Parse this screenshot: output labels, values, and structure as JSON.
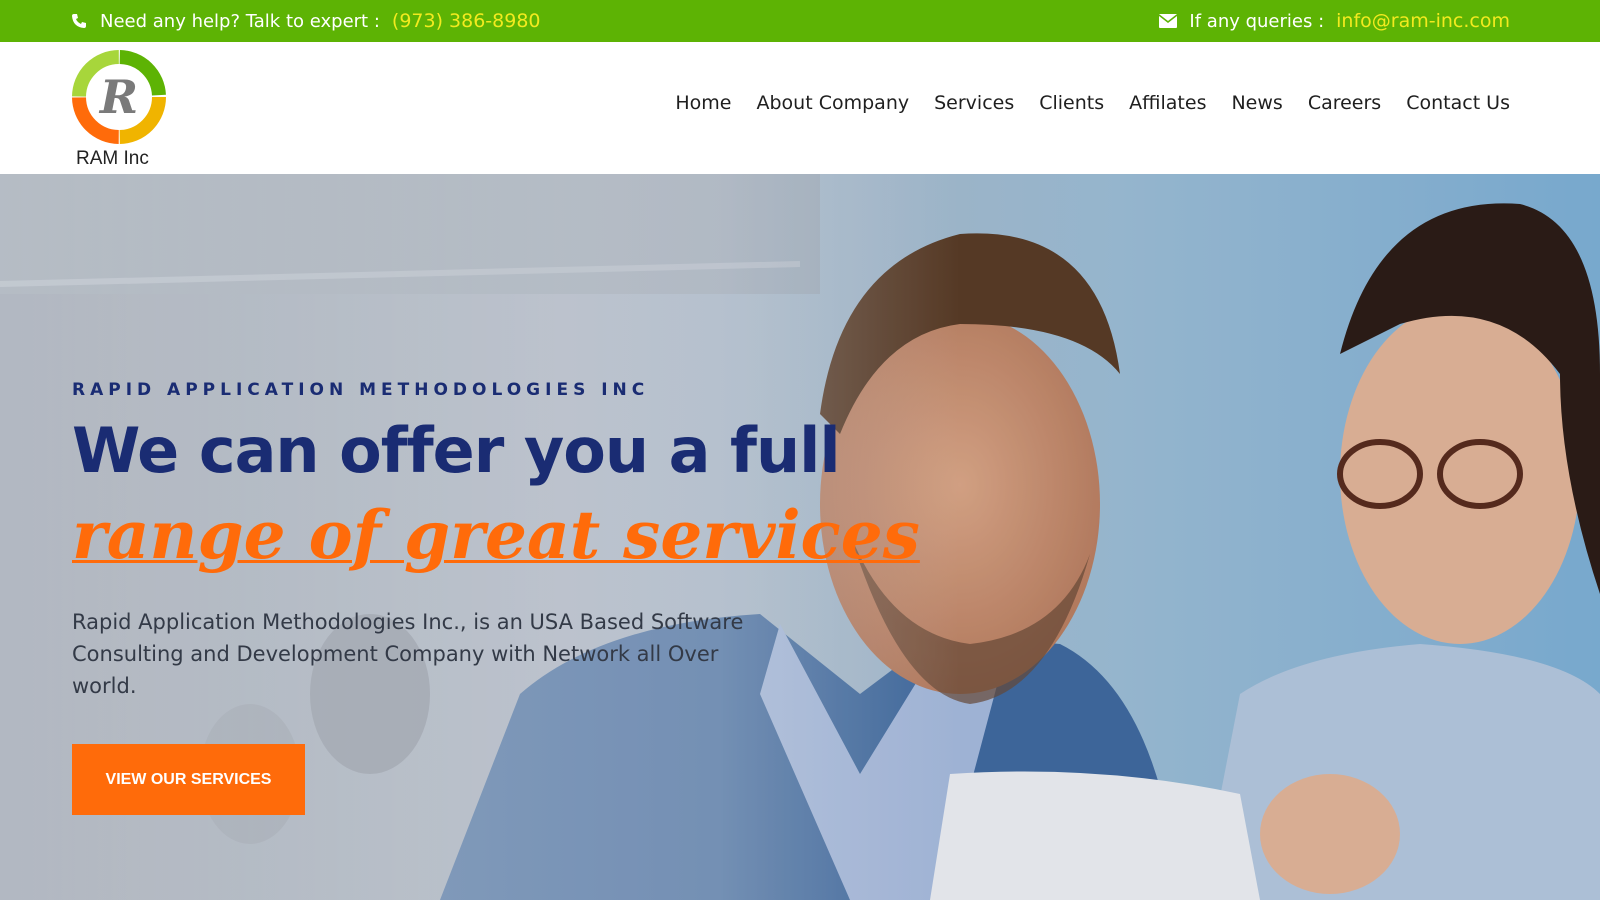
{
  "topbar": {
    "help_label": "Need any help? Talk to expert :",
    "phone": "(973) 386-8980",
    "query_label": "If any queries :",
    "email": "info@ram-inc.com",
    "phone_icon": "phone-icon",
    "mail_icon": "envelope-icon",
    "bg_color": "#5db304",
    "accent_color": "#f2ea1f"
  },
  "brand": {
    "name": "RAM Inc",
    "logo_letter": "R"
  },
  "nav": {
    "items": [
      {
        "label": "Home"
      },
      {
        "label": "About Company"
      },
      {
        "label": "Services"
      },
      {
        "label": "Clients"
      },
      {
        "label": "Affilates"
      },
      {
        "label": "News"
      },
      {
        "label": "Careers"
      },
      {
        "label": "Contact Us"
      }
    ]
  },
  "hero": {
    "eyebrow": "RAPID APPLICATION METHODOLOGIES INC",
    "headline_line1": "We can offer you a full",
    "headline_line2": "range of great services",
    "description": "Rapid Application Methodologies Inc., is an USA Based Software Consulting and Development Company with Network all Over world.",
    "cta_label": "VIEW OUR SERVICES",
    "navy_color": "#1a2c73",
    "orange_color": "#ff6b0a"
  }
}
